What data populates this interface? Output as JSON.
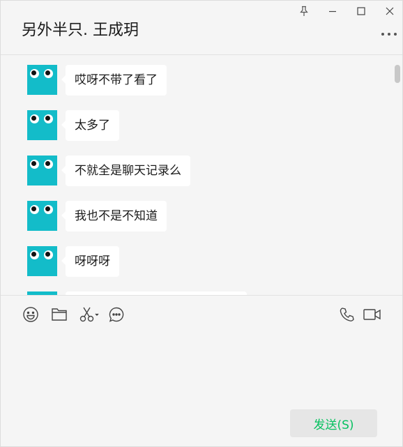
{
  "header": {
    "title": "另外半只. 王成玥"
  },
  "window_controls": {
    "pin_icon": "pin-icon",
    "minimize_icon": "minimize-icon",
    "maximize_icon": "maximize-icon",
    "close_icon": "close-icon",
    "more_icon": "more-options-icon"
  },
  "messages": [
    {
      "text": "哎呀不带了看了"
    },
    {
      "text": "太多了"
    },
    {
      "text": "不就全是聊天记录么"
    },
    {
      "text": "我也不是不知道"
    },
    {
      "text": "呀呀呀"
    },
    {
      "text": ""
    }
  ],
  "toolbar": {
    "left": [
      "emoji-icon",
      "folder-icon",
      "scissors-icon",
      "chat-history-icon"
    ],
    "right": [
      "phone-icon",
      "video-icon"
    ]
  },
  "composer": {
    "value": "",
    "send_label": "发送(S)"
  },
  "colors": {
    "avatar": "#13bcc9",
    "send_text": "#07c160",
    "background": "#f5f5f5"
  }
}
